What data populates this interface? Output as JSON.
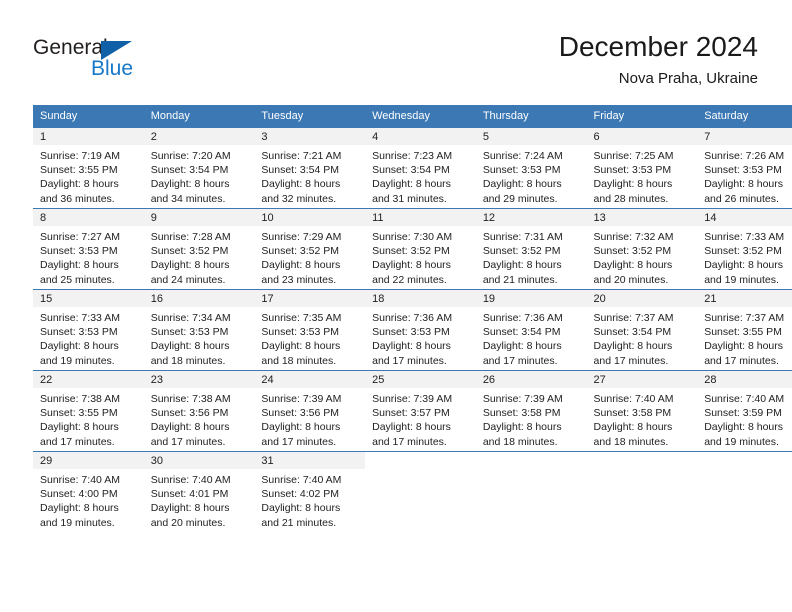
{
  "brand": {
    "name_part1": "General",
    "name_part2": "Blue",
    "triangle_icon": "triangle-icon",
    "accent_color": "#1878c8",
    "triangle_color": "#1060a8"
  },
  "header": {
    "title": "December 2024",
    "subtitle": "Nova Praha, Ukraine"
  },
  "colors": {
    "header_row_bg": "#3b78b4",
    "day_band_bg": "#f2f2f2",
    "row_divider": "#3b78b4",
    "text": "#222222"
  },
  "weekday_headers": [
    "Sunday",
    "Monday",
    "Tuesday",
    "Wednesday",
    "Thursday",
    "Friday",
    "Saturday"
  ],
  "weeks": [
    [
      {
        "day": "1",
        "sunrise": "Sunrise: 7:19 AM",
        "sunset": "Sunset: 3:55 PM",
        "daylight1": "Daylight: 8 hours",
        "daylight2": "and 36 minutes."
      },
      {
        "day": "2",
        "sunrise": "Sunrise: 7:20 AM",
        "sunset": "Sunset: 3:54 PM",
        "daylight1": "Daylight: 8 hours",
        "daylight2": "and 34 minutes."
      },
      {
        "day": "3",
        "sunrise": "Sunrise: 7:21 AM",
        "sunset": "Sunset: 3:54 PM",
        "daylight1": "Daylight: 8 hours",
        "daylight2": "and 32 minutes."
      },
      {
        "day": "4",
        "sunrise": "Sunrise: 7:23 AM",
        "sunset": "Sunset: 3:54 PM",
        "daylight1": "Daylight: 8 hours",
        "daylight2": "and 31 minutes."
      },
      {
        "day": "5",
        "sunrise": "Sunrise: 7:24 AM",
        "sunset": "Sunset: 3:53 PM",
        "daylight1": "Daylight: 8 hours",
        "daylight2": "and 29 minutes."
      },
      {
        "day": "6",
        "sunrise": "Sunrise: 7:25 AM",
        "sunset": "Sunset: 3:53 PM",
        "daylight1": "Daylight: 8 hours",
        "daylight2": "and 28 minutes."
      },
      {
        "day": "7",
        "sunrise": "Sunrise: 7:26 AM",
        "sunset": "Sunset: 3:53 PM",
        "daylight1": "Daylight: 8 hours",
        "daylight2": "and 26 minutes."
      }
    ],
    [
      {
        "day": "8",
        "sunrise": "Sunrise: 7:27 AM",
        "sunset": "Sunset: 3:53 PM",
        "daylight1": "Daylight: 8 hours",
        "daylight2": "and 25 minutes."
      },
      {
        "day": "9",
        "sunrise": "Sunrise: 7:28 AM",
        "sunset": "Sunset: 3:52 PM",
        "daylight1": "Daylight: 8 hours",
        "daylight2": "and 24 minutes."
      },
      {
        "day": "10",
        "sunrise": "Sunrise: 7:29 AM",
        "sunset": "Sunset: 3:52 PM",
        "daylight1": "Daylight: 8 hours",
        "daylight2": "and 23 minutes."
      },
      {
        "day": "11",
        "sunrise": "Sunrise: 7:30 AM",
        "sunset": "Sunset: 3:52 PM",
        "daylight1": "Daylight: 8 hours",
        "daylight2": "and 22 minutes."
      },
      {
        "day": "12",
        "sunrise": "Sunrise: 7:31 AM",
        "sunset": "Sunset: 3:52 PM",
        "daylight1": "Daylight: 8 hours",
        "daylight2": "and 21 minutes."
      },
      {
        "day": "13",
        "sunrise": "Sunrise: 7:32 AM",
        "sunset": "Sunset: 3:52 PM",
        "daylight1": "Daylight: 8 hours",
        "daylight2": "and 20 minutes."
      },
      {
        "day": "14",
        "sunrise": "Sunrise: 7:33 AM",
        "sunset": "Sunset: 3:52 PM",
        "daylight1": "Daylight: 8 hours",
        "daylight2": "and 19 minutes."
      }
    ],
    [
      {
        "day": "15",
        "sunrise": "Sunrise: 7:33 AM",
        "sunset": "Sunset: 3:53 PM",
        "daylight1": "Daylight: 8 hours",
        "daylight2": "and 19 minutes."
      },
      {
        "day": "16",
        "sunrise": "Sunrise: 7:34 AM",
        "sunset": "Sunset: 3:53 PM",
        "daylight1": "Daylight: 8 hours",
        "daylight2": "and 18 minutes."
      },
      {
        "day": "17",
        "sunrise": "Sunrise: 7:35 AM",
        "sunset": "Sunset: 3:53 PM",
        "daylight1": "Daylight: 8 hours",
        "daylight2": "and 18 minutes."
      },
      {
        "day": "18",
        "sunrise": "Sunrise: 7:36 AM",
        "sunset": "Sunset: 3:53 PM",
        "daylight1": "Daylight: 8 hours",
        "daylight2": "and 17 minutes."
      },
      {
        "day": "19",
        "sunrise": "Sunrise: 7:36 AM",
        "sunset": "Sunset: 3:54 PM",
        "daylight1": "Daylight: 8 hours",
        "daylight2": "and 17 minutes."
      },
      {
        "day": "20",
        "sunrise": "Sunrise: 7:37 AM",
        "sunset": "Sunset: 3:54 PM",
        "daylight1": "Daylight: 8 hours",
        "daylight2": "and 17 minutes."
      },
      {
        "day": "21",
        "sunrise": "Sunrise: 7:37 AM",
        "sunset": "Sunset: 3:55 PM",
        "daylight1": "Daylight: 8 hours",
        "daylight2": "and 17 minutes."
      }
    ],
    [
      {
        "day": "22",
        "sunrise": "Sunrise: 7:38 AM",
        "sunset": "Sunset: 3:55 PM",
        "daylight1": "Daylight: 8 hours",
        "daylight2": "and 17 minutes."
      },
      {
        "day": "23",
        "sunrise": "Sunrise: 7:38 AM",
        "sunset": "Sunset: 3:56 PM",
        "daylight1": "Daylight: 8 hours",
        "daylight2": "and 17 minutes."
      },
      {
        "day": "24",
        "sunrise": "Sunrise: 7:39 AM",
        "sunset": "Sunset: 3:56 PM",
        "daylight1": "Daylight: 8 hours",
        "daylight2": "and 17 minutes."
      },
      {
        "day": "25",
        "sunrise": "Sunrise: 7:39 AM",
        "sunset": "Sunset: 3:57 PM",
        "daylight1": "Daylight: 8 hours",
        "daylight2": "and 17 minutes."
      },
      {
        "day": "26",
        "sunrise": "Sunrise: 7:39 AM",
        "sunset": "Sunset: 3:58 PM",
        "daylight1": "Daylight: 8 hours",
        "daylight2": "and 18 minutes."
      },
      {
        "day": "27",
        "sunrise": "Sunrise: 7:40 AM",
        "sunset": "Sunset: 3:58 PM",
        "daylight1": "Daylight: 8 hours",
        "daylight2": "and 18 minutes."
      },
      {
        "day": "28",
        "sunrise": "Sunrise: 7:40 AM",
        "sunset": "Sunset: 3:59 PM",
        "daylight1": "Daylight: 8 hours",
        "daylight2": "and 19 minutes."
      }
    ],
    [
      {
        "day": "29",
        "sunrise": "Sunrise: 7:40 AM",
        "sunset": "Sunset: 4:00 PM",
        "daylight1": "Daylight: 8 hours",
        "daylight2": "and 19 minutes."
      },
      {
        "day": "30",
        "sunrise": "Sunrise: 7:40 AM",
        "sunset": "Sunset: 4:01 PM",
        "daylight1": "Daylight: 8 hours",
        "daylight2": "and 20 minutes."
      },
      {
        "day": "31",
        "sunrise": "Sunrise: 7:40 AM",
        "sunset": "Sunset: 4:02 PM",
        "daylight1": "Daylight: 8 hours",
        "daylight2": "and 21 minutes."
      },
      null,
      null,
      null,
      null
    ]
  ]
}
